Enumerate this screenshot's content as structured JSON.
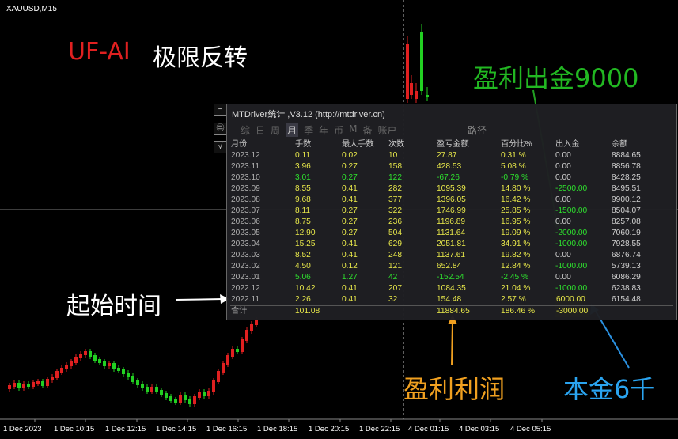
{
  "chart": {
    "symbol": "XAUUSD,M15",
    "x_labels": [
      "1 Dec 2023",
      "1 Dec 10:15",
      "1 Dec 12:15",
      "1 Dec 14:15",
      "1 Dec 16:15",
      "1 Dec 18:15",
      "1 Dec 20:15",
      "1 Dec 22:15",
      "4 Dec 01:15",
      "4 Dec 03:15",
      "4 Dec 05:15"
    ],
    "bull_color": "#e02020",
    "bear_color": "#22d022"
  },
  "header": {
    "brand": "UF-AI",
    "title": "极限反转"
  },
  "annotations": {
    "profit_withdraw": "盈利出金9000",
    "start_time": "起始时间",
    "profit": "盈利利润",
    "capital": "本金6千"
  },
  "side_buttons": [
    "−",
    "㊁",
    "√"
  ],
  "panel": {
    "title": "MTDriver统计 ,V3.12 (http://mtdriver.cn)",
    "tabs": [
      "综",
      "日",
      "周",
      "月",
      "季",
      "年",
      "币",
      "M",
      "备",
      "账户"
    ],
    "active_tab": "月",
    "path_label": "路径",
    "columns": [
      "月份",
      "手数",
      "最大手数",
      "次数",
      "盈亏金额",
      "百分比%",
      "出入金",
      "余额"
    ],
    "rows": [
      [
        "2023.12",
        "0.11",
        "0.02",
        "10",
        "27.87",
        "0.31 %",
        "0.00",
        "8884.65"
      ],
      [
        "2023.11",
        "3.96",
        "0.27",
        "158",
        "428.53",
        "5.08 %",
        "0.00",
        "8856.78"
      ],
      [
        "2023.10",
        "3.01",
        "0.27",
        "122",
        "-67.26",
        "-0.79 %",
        "0.00",
        "8428.25"
      ],
      [
        "2023.09",
        "8.55",
        "0.41",
        "282",
        "1095.39",
        "14.80 %",
        "-2500.00",
        "8495.51"
      ],
      [
        "2023.08",
        "9.68",
        "0.41",
        "377",
        "1396.05",
        "16.42 %",
        "0.00",
        "9900.12"
      ],
      [
        "2023.07",
        "8.11",
        "0.27",
        "322",
        "1746.99",
        "25.85 %",
        "-1500.00",
        "8504.07"
      ],
      [
        "2023.06",
        "8.75",
        "0.27",
        "236",
        "1196.89",
        "16.95 %",
        "0.00",
        "8257.08"
      ],
      [
        "2023.05",
        "12.90",
        "0.27",
        "504",
        "1131.64",
        "19.09 %",
        "-2000.00",
        "7060.19"
      ],
      [
        "2023.04",
        "15.25",
        "0.41",
        "629",
        "2051.81",
        "34.91 %",
        "-1000.00",
        "7928.55"
      ],
      [
        "2023.03",
        "8.52",
        "0.41",
        "248",
        "1137.61",
        "19.82 %",
        "0.00",
        "6876.74"
      ],
      [
        "2023.02",
        "4.50",
        "0.12",
        "121",
        "652.84",
        "12.84 %",
        "-1000.00",
        "5739.13"
      ],
      [
        "2023.01",
        "5.06",
        "1.27",
        "42",
        "-152.54",
        "-2.45 %",
        "0.00",
        "6086.29"
      ],
      [
        "2022.12",
        "10.42",
        "0.41",
        "207",
        "1084.35",
        "21.04 %",
        "-1000.00",
        "6238.83"
      ],
      [
        "2022.11",
        "2.26",
        "0.41",
        "32",
        "154.48",
        "2.57 %",
        "6000.00",
        "6154.48"
      ]
    ],
    "total": [
      "合计",
      "101.08",
      "",
      "",
      "11884.65",
      "186.46 %",
      "-3000.00",
      ""
    ]
  }
}
